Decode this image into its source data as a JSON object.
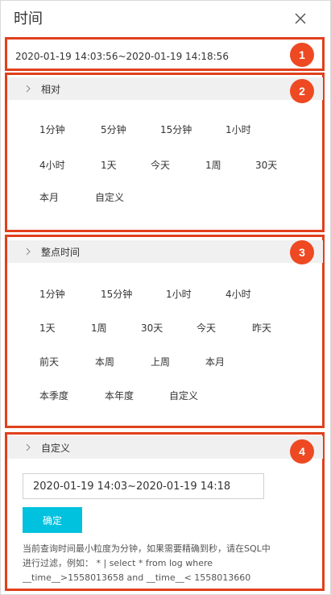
{
  "dialog": {
    "title": "时间",
    "close_icon": "close-icon"
  },
  "range_display": "2020-01-19 14:03:56~2020-01-19 14:18:56",
  "badges": [
    "1",
    "2",
    "3",
    "4"
  ],
  "accent_color": "#ee4922",
  "relative": {
    "label": "相对",
    "options": [
      "1分钟",
      "5分钟",
      "15分钟",
      "1小时",
      "4小时",
      "1天",
      "今天",
      "1周",
      "30天",
      "本月",
      "自定义"
    ]
  },
  "whole": {
    "label": "整点时间",
    "options": [
      "1分钟",
      "15分钟",
      "1小时",
      "4小时",
      "1天",
      "1周",
      "30天",
      "今天",
      "昨天",
      "前天",
      "本周",
      "上周",
      "本月",
      "本季度",
      "本年度",
      "自定义"
    ]
  },
  "custom": {
    "label": "自定义",
    "input_value": "2020-01-19 14:03~2020-01-19 14:18",
    "confirm_label": "确定",
    "confirm_color": "#00c1de",
    "note_line1": "当前查询时间最小粒度为分钟，如果需要精确到秒，请在SQL中",
    "note_line2": "进行过滤，例如： * | select * from log where",
    "note_line3": "__time__>1558013658 and __time__< 1558013660"
  }
}
